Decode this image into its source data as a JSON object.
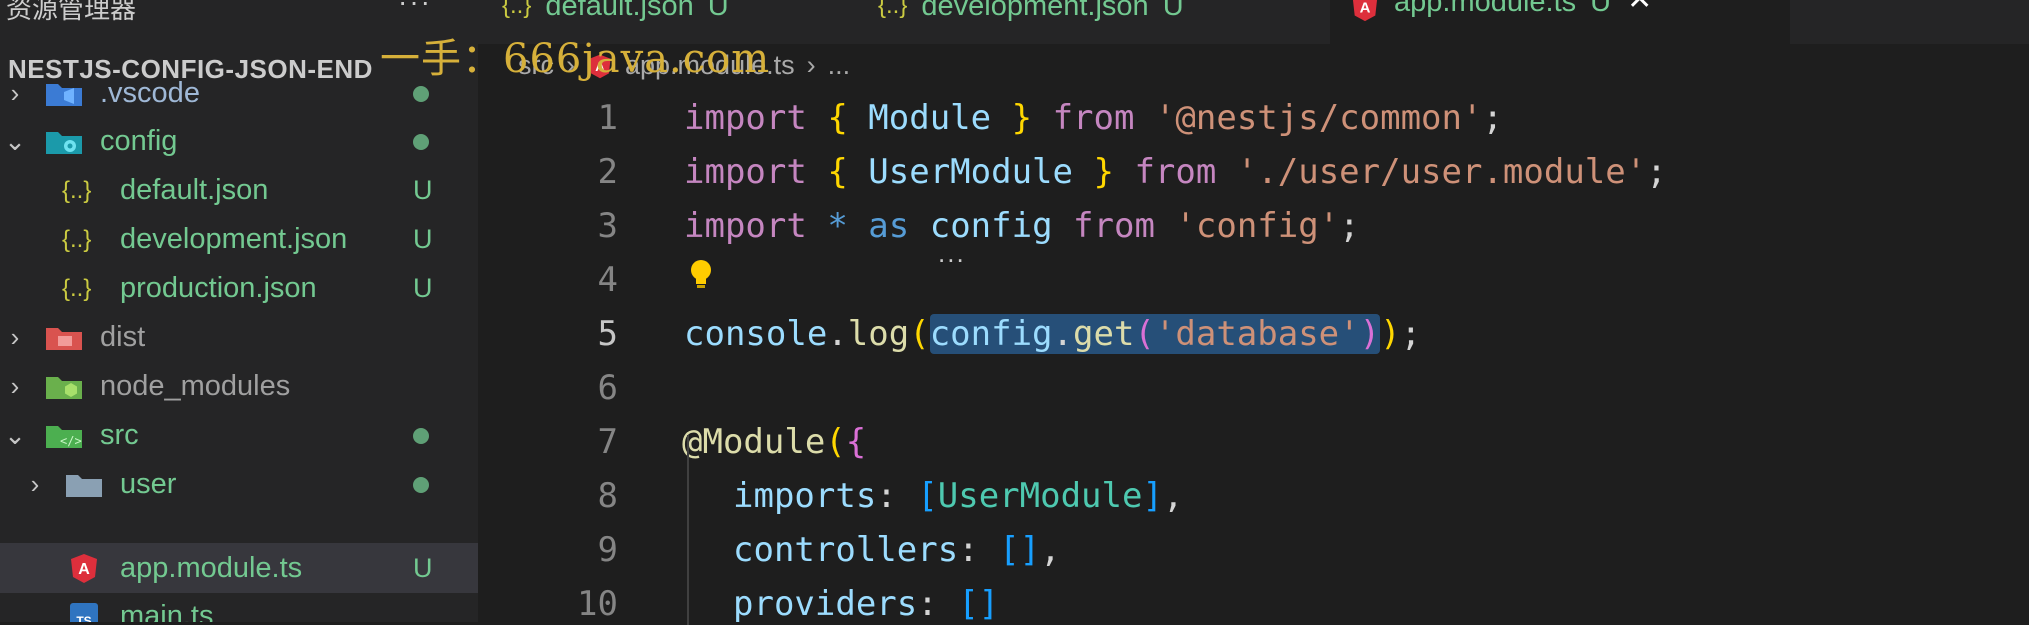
{
  "sidebar": {
    "header": "资源管理器",
    "more": "···",
    "project": "NESTJS-CONFIG-JSON-END",
    "items": [
      {
        "label": ".vscode",
        "status": ""
      },
      {
        "label": "config",
        "status": ""
      },
      {
        "label": "default.json",
        "status": "U"
      },
      {
        "label": "development.json",
        "status": "U"
      },
      {
        "label": "production.json",
        "status": "U"
      },
      {
        "label": "dist",
        "status": ""
      },
      {
        "label": "node_modules",
        "status": ""
      },
      {
        "label": "src",
        "status": ""
      },
      {
        "label": "user",
        "status": ""
      },
      {
        "label": "app.module.ts",
        "status": "U"
      },
      {
        "label": "main.ts",
        "status": ""
      }
    ]
  },
  "tabs": [
    {
      "icon": "{..}",
      "label": "default.json",
      "status": "U"
    },
    {
      "icon": "{..}",
      "label": "development.json",
      "status": "U"
    },
    {
      "icon": "A",
      "label": "app.module.ts",
      "status": "U",
      "close": "✕"
    }
  ],
  "breadcrumb": {
    "folder": "src",
    "file": "app.module.ts",
    "tail": "..."
  },
  "watermark": "一手：666java.com",
  "editor": {
    "lines": [
      "1",
      "2",
      "3",
      "4",
      "5",
      "6",
      "7",
      "8",
      "9",
      "10"
    ],
    "hint_dots": "...",
    "code": {
      "l1": {
        "kw": "import",
        "b1": "{",
        "name": "Module",
        "b2": "}",
        "from": "from",
        "str": "'@nestjs/common'",
        "end": ";"
      },
      "l2": {
        "kw": "import",
        "b1": "{",
        "name": "UserModule",
        "b2": "}",
        "from": "from",
        "str": "'./user/user.module'",
        "end": ";"
      },
      "l3": {
        "kw": "import",
        "star": "*",
        "as": "as",
        "name": "config",
        "from": "from",
        "str": "'config'",
        "end": ";"
      },
      "l5": {
        "obj": "console",
        "dot": ".",
        "fn": "log",
        "p1": "(",
        "obj2": "config",
        "dot2": ".",
        "fn2": "get",
        "p2": "(",
        "str": "'database'",
        "p3": ")",
        "p4": ")",
        "end": ";"
      },
      "l7": {
        "at": "@Module",
        "p": "(",
        "b": "{"
      },
      "l8": {
        "key": "imports",
        "colon": ":",
        "b1": "[",
        "val": "UserModule",
        "b2": "]",
        "comma": ","
      },
      "l9": {
        "key": "controllers",
        "colon": ":",
        "b": "[]",
        "comma": ","
      },
      "l10": {
        "key": "providers",
        "colon": ":",
        "b": "[]"
      }
    }
  }
}
